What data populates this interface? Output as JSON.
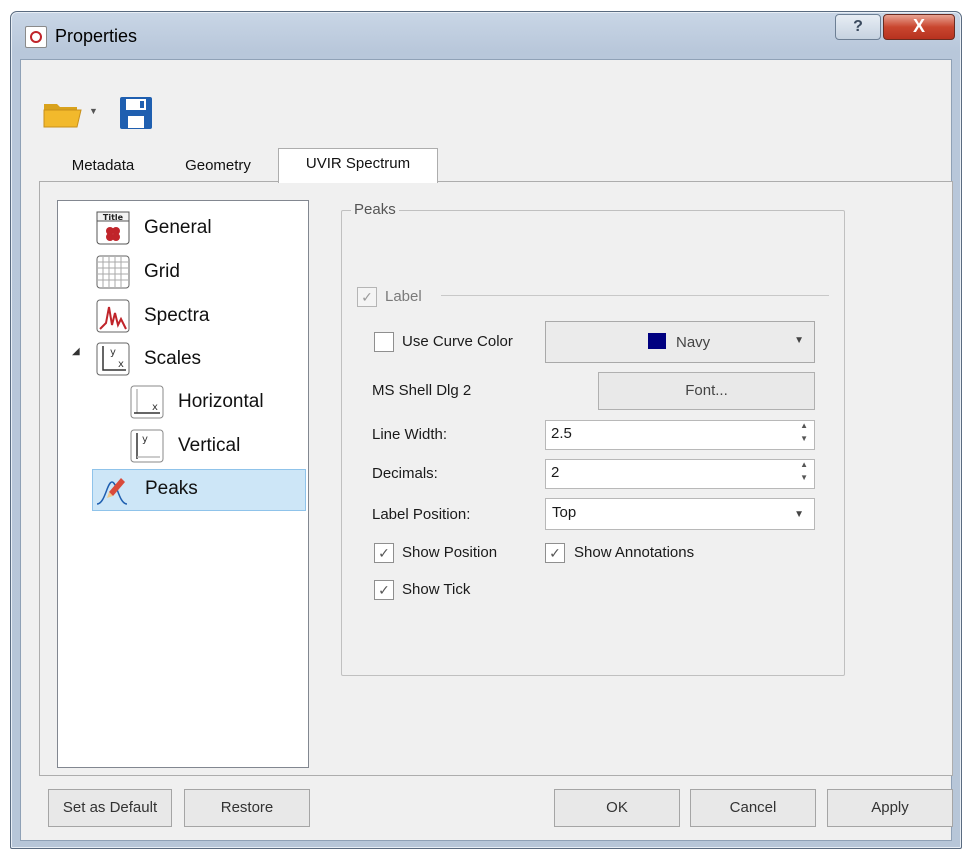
{
  "window": {
    "title": "Properties",
    "help_glyph": "?",
    "close_glyph": "X"
  },
  "toolbar": {
    "open_icon": "folder-open-icon",
    "dropdown_glyph": "▼",
    "save_icon": "floppy-disk-icon"
  },
  "tabs": [
    {
      "label": "Metadata"
    },
    {
      "label": "Geometry"
    },
    {
      "label": "UVIR Spectrum"
    }
  ],
  "tree": {
    "expander_glyph": "◢",
    "items": [
      {
        "label": "General"
      },
      {
        "label": "Grid"
      },
      {
        "label": "Spectra"
      },
      {
        "label": "Scales"
      },
      {
        "label": "Horizontal"
      },
      {
        "label": "Vertical"
      },
      {
        "label": "Peaks"
      }
    ],
    "selected": "Peaks"
  },
  "peaks": {
    "group_title": "Peaks",
    "label_checkbox": {
      "label": "Label",
      "checked": true
    },
    "use_curve_color": {
      "label": "Use Curve Color",
      "checked": false
    },
    "color": {
      "name": "Navy",
      "hex": "#000080"
    },
    "font_name": "MS Shell Dlg 2",
    "font_button": "Font...",
    "line_width": {
      "label": "Line Width:",
      "value": "2.5"
    },
    "decimals": {
      "label": "Decimals:",
      "value": "2"
    },
    "label_position": {
      "label": "Label Position:",
      "value": "Top"
    },
    "show_position": {
      "label": "Show Position",
      "checked": true
    },
    "show_annotations": {
      "label": "Show Annotations",
      "checked": true
    },
    "show_tick": {
      "label": "Show Tick",
      "checked": true
    }
  },
  "buttons": {
    "set_default": "Set as Default",
    "restore": "Restore",
    "ok": "OK",
    "cancel": "Cancel",
    "apply": "Apply"
  },
  "glyphs": {
    "check": "✓",
    "spin_up": "▲",
    "spin_down": "▼",
    "combo_arrow": "▼"
  }
}
